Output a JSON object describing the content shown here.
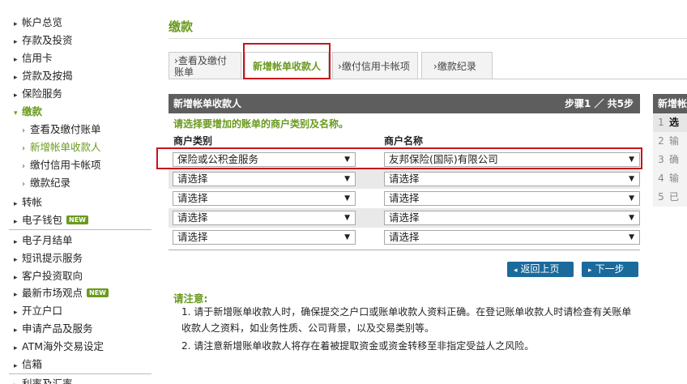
{
  "sidebar": {
    "items": [
      {
        "label": "帐户总览"
      },
      {
        "label": "存款及投资"
      },
      {
        "label": "信用卡"
      },
      {
        "label": "贷款及按揭"
      },
      {
        "label": "保险服务"
      },
      {
        "label": "缴款",
        "active": true
      },
      {
        "label": "转帐"
      },
      {
        "label": "电子钱包",
        "badge": "NEW"
      },
      {
        "label": "电子月结单"
      },
      {
        "label": "短讯提示服务"
      },
      {
        "label": "客户投资取向"
      },
      {
        "label": "最新市场观点",
        "badge": "NEW"
      },
      {
        "label": "开立户口"
      },
      {
        "label": "申请产品及服务"
      },
      {
        "label": "ATM海外交易设定"
      },
      {
        "label": "信箱"
      },
      {
        "label": "利率及汇率"
      }
    ],
    "sub_items": [
      {
        "label": "查看及缴付账单"
      },
      {
        "label": "新增帐单收款人",
        "current": true
      },
      {
        "label": "缴付信用卡帐项"
      },
      {
        "label": "缴款纪录"
      }
    ]
  },
  "main": {
    "title": "缴款",
    "tabs": [
      {
        "label": "查看及缴付账单"
      },
      {
        "label": "新增帐单收款人",
        "active": true
      },
      {
        "label": "缴付信用卡帐项"
      },
      {
        "label": "缴款纪录"
      }
    ],
    "panel": {
      "title": "新增帐单收款人",
      "step": "步骤1 ／ 共5步",
      "instruction": "请选择要增加的账单的商户类别及名称。",
      "col_category": "商户类别",
      "col_name": "商户名称",
      "rows": [
        {
          "category": "保险或公积金服务",
          "name": "友邦保险(国际)有限公司"
        },
        {
          "category": "请选择",
          "name": "请选择"
        },
        {
          "category": "请选择",
          "name": "请选择"
        },
        {
          "category": "请选择",
          "name": "请选择"
        },
        {
          "category": "请选择",
          "name": "请选择"
        }
      ]
    },
    "buttons": {
      "back": "返回上页",
      "next": "下一步"
    },
    "notes": {
      "title": "请注意:",
      "items": [
        "1. 请于新增账单收款人时，确保提交之户口或账单收款人资料正确。在登记账单收款人时请检查有关账单收款人之资料，如业务性质、公司背景，以及交易类别等。",
        "2. 请注意新增账单收款人将存在着被提取资金或资金转移至非指定受益人之风险。"
      ]
    }
  },
  "right_panel": {
    "title": "新增帐",
    "steps": [
      {
        "num": "1",
        "label": "选",
        "current": true
      },
      {
        "num": "2",
        "label": "输"
      },
      {
        "num": "3",
        "label": "确"
      },
      {
        "num": "4",
        "label": "输"
      },
      {
        "num": "5",
        "label": "已"
      }
    ]
  },
  "colors": {
    "accent_green": "#6a9a1f",
    "header_gray": "#5e5e5e",
    "button_blue": "#1a6a9c",
    "highlight_red": "#c8141c"
  },
  "icons": {
    "nav_arrow": "arrow-right-icon",
    "sub_arrow": "chevron-right-icon",
    "select_caret": "caret-down-icon",
    "btn_back": "triangle-left-icon",
    "btn_next": "triangle-right-icon"
  }
}
